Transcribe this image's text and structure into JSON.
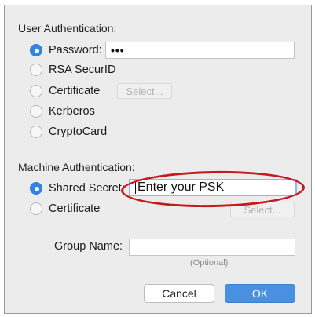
{
  "user_auth": {
    "heading": "User Authentication:",
    "options": [
      {
        "label": "Password:",
        "checked": true
      },
      {
        "label": "RSA SecurID",
        "checked": false
      },
      {
        "label": "Certificate",
        "checked": false
      },
      {
        "label": "Kerberos",
        "checked": false
      },
      {
        "label": "CryptoCard",
        "checked": false
      }
    ],
    "password_value": "•••",
    "select_label": "Select..."
  },
  "machine_auth": {
    "heading": "Machine Authentication:",
    "options": [
      {
        "label": "Shared Secret:",
        "checked": true
      },
      {
        "label": "Certificate",
        "checked": false
      }
    ],
    "psk_value": "Enter your PSK",
    "select_label": "Select..."
  },
  "group": {
    "label": "Group Name:",
    "value": "",
    "hint": "(Optional)"
  },
  "buttons": {
    "cancel": "Cancel",
    "ok": "OK"
  },
  "colors": {
    "accent": "#4a90e2",
    "highlight": "#c8191e"
  }
}
